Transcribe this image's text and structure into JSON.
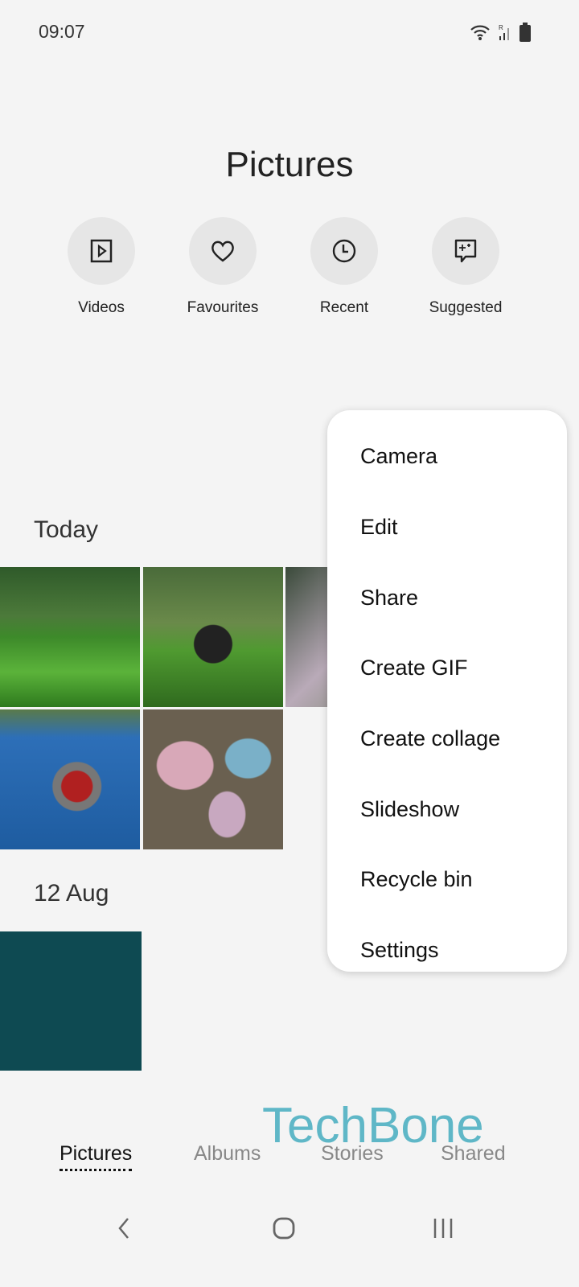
{
  "status": {
    "time": "09:07",
    "icons": [
      "wifi-icon",
      "signal-roaming-icon",
      "battery-icon"
    ]
  },
  "header": {
    "title": "Pictures"
  },
  "quick_actions": [
    {
      "label": "Videos",
      "icon": "video-icon"
    },
    {
      "label": "Favourites",
      "icon": "heart-icon"
    },
    {
      "label": "Recent",
      "icon": "clock-icon"
    },
    {
      "label": "Suggested",
      "icon": "sparkle-chat-icon"
    }
  ],
  "sections": [
    {
      "label": "Today",
      "photos": [
        "grass-trees",
        "panda-toy-grass",
        "pebbles-partial",
        "toy-car",
        "chalk-stones"
      ]
    },
    {
      "label": "12 Aug",
      "photos": [
        "dark-teal"
      ]
    }
  ],
  "menu": {
    "items": [
      "Camera",
      "Edit",
      "Share",
      "Create GIF",
      "Create collage",
      "Slideshow",
      "Recycle bin",
      "Settings"
    ]
  },
  "bottom_tabs": [
    {
      "label": "Pictures",
      "active": true
    },
    {
      "label": "Albums"
    },
    {
      "label": "Stories"
    },
    {
      "label": "Shared"
    }
  ],
  "watermark": "TechBone",
  "nav": [
    "back-icon",
    "home-icon",
    "recents-icon"
  ],
  "colors": {
    "background": "#f4f4f4",
    "watermark": "#5fb7c7"
  }
}
